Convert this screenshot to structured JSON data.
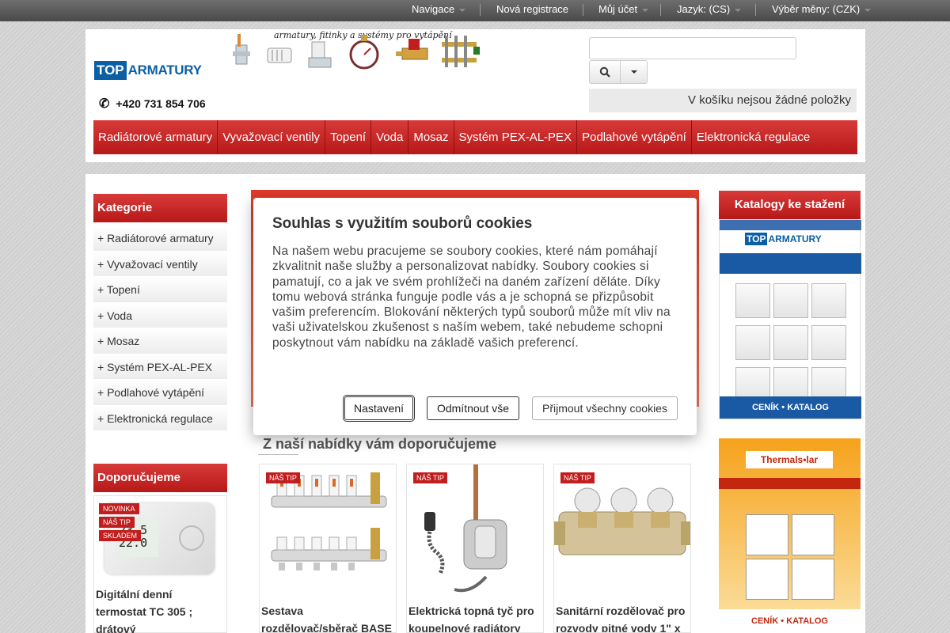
{
  "topbar": {
    "items": [
      "Navigace",
      "Nová registrace",
      "Můj účet",
      "Jazyk: (CS)",
      "Výběr měny: (CZK)"
    ]
  },
  "header": {
    "logo_top": "TOP",
    "logo_rest": "ARMATURY",
    "tagline": "armatury, fitinky a systémy pro vytápění",
    "phone": "+420 731 854 706",
    "cart_text": "V košíku nejsou žádné položky"
  },
  "nav": {
    "items": [
      "Radiátorové armatury",
      "Vyvažovací ventily",
      "Topení",
      "Voda",
      "Mosaz",
      "Systém PEX-AL-PEX",
      "Podlahové vytápění",
      "Elektronická regulace"
    ]
  },
  "sidebar": {
    "categories_title": "Kategorie",
    "categories": [
      "+ Radiátorové armatury",
      "+ Vyvažovací ventily",
      "+ Topení",
      "+ Voda",
      "+ Mosaz",
      "+ Systém PEX-AL-PEX",
      "+ Podlahové vytápění",
      "+ Elektronická regulace"
    ],
    "recommend_title": "Doporučujeme",
    "recommend_badges": [
      "NOVINKA",
      "NÁŠ TIP",
      "SKLADEM"
    ],
    "thermo_display": [
      "23.5",
      "22.0"
    ],
    "recommend_product": "Digitální denní termostat TC 305 ; drátový"
  },
  "main": {
    "recommend_heading": "Z naší nabídky vám doporučujeme",
    "products": [
      {
        "badge": "NÁŠ TIP",
        "title": "Sestava rozdělovač/sběrač BASE"
      },
      {
        "badge": "NÁŠ TIP",
        "title": "Elektrická topná tyč pro koupelnové radiátory"
      },
      {
        "badge": "NÁŠ TIP",
        "title": "Sanitární rozdělovač pro rozvody pitné vody 1\" x"
      }
    ]
  },
  "right": {
    "catalogs_title": "Katalogy ke stažení",
    "catalog1_logo_top": "TOP",
    "catalog1_logo_rest": "ARMATURY",
    "catalog1_footer": "CENÍK • KATALOG",
    "catalog2_brand": "Thermals•lar",
    "catalog2_footer": "CENÍK • KATALOG"
  },
  "cookie": {
    "title": "Souhlas s využitím souborů cookies",
    "body": "Na našem webu pracujeme se soubory cookies, které nám pomáhají zkvalitnit naše služby a personalizovat nabídky. Soubory cookies si pamatují, co a jak ve svém prohlížeči na daném zařízení děláte. Díky tomu webová stránka funguje podle vás a je schopná se přizpůsobit vašim preferencím. Blokování některých typů souborů může mít vliv na vaši uživatelskou zkušenost s naším webem, také nebudeme schopni poskytnout vám nabídku na základě vašich preferencí.",
    "btn_settings": "Nastavení",
    "btn_reject": "Odmítnout vše",
    "btn_accept": "Přijmout všechny cookies"
  },
  "colors": {
    "accent_red": "#c11f1f",
    "brand_blue": "#0b5fa5"
  }
}
